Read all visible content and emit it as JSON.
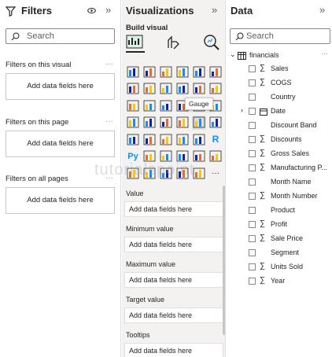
{
  "filters": {
    "title": "Filters",
    "search_placeholder": "Search",
    "sections": [
      {
        "label": "Filters on this visual",
        "drop": "Add data fields here"
      },
      {
        "label": "Filters on this page",
        "drop": "Add data fields here"
      },
      {
        "label": "Filters on all pages",
        "drop": "Add data fields here"
      }
    ],
    "more": "…"
  },
  "viz": {
    "title": "Visualizations",
    "build_label": "Build visual",
    "tooltip": "Gauge",
    "wells": [
      {
        "label": "Value",
        "drop": "Add data fields here"
      },
      {
        "label": "Minimum value",
        "drop": "Add data fields here"
      },
      {
        "label": "Maximum value",
        "drop": "Add data fields here"
      },
      {
        "label": "Target value",
        "drop": "Add data fields here"
      },
      {
        "label": "Tooltips",
        "drop": "Add data fields here"
      }
    ],
    "icon_r": "R",
    "icon_py": "Py",
    "icon_more": "···"
  },
  "data": {
    "title": "Data",
    "search_placeholder": "Search",
    "table": "financials",
    "more": "···",
    "fields": [
      {
        "name": "Sales",
        "sigma": true
      },
      {
        "name": "COGS",
        "sigma": true
      },
      {
        "name": "Country",
        "sigma": false
      },
      {
        "name": "Date",
        "sigma": false,
        "date": true
      },
      {
        "name": "Discount Band",
        "sigma": false
      },
      {
        "name": "Discounts",
        "sigma": true
      },
      {
        "name": "Gross Sales",
        "sigma": true
      },
      {
        "name": "Manufacturing P...",
        "sigma": true
      },
      {
        "name": "Month Name",
        "sigma": false
      },
      {
        "name": "Month Number",
        "sigma": true
      },
      {
        "name": "Product",
        "sigma": false
      },
      {
        "name": "Profit",
        "sigma": true
      },
      {
        "name": "Sale Price",
        "sigma": true
      },
      {
        "name": "Segment",
        "sigma": false
      },
      {
        "name": "Units Sold",
        "sigma": true
      },
      {
        "name": "Year",
        "sigma": true
      }
    ],
    "sigma": "∑"
  },
  "watermark": "tutorialspoint",
  "colors": {
    "accent_yellow": "#f2c811",
    "accent_blue": "#118dff",
    "accent_teal": "#12239e"
  }
}
